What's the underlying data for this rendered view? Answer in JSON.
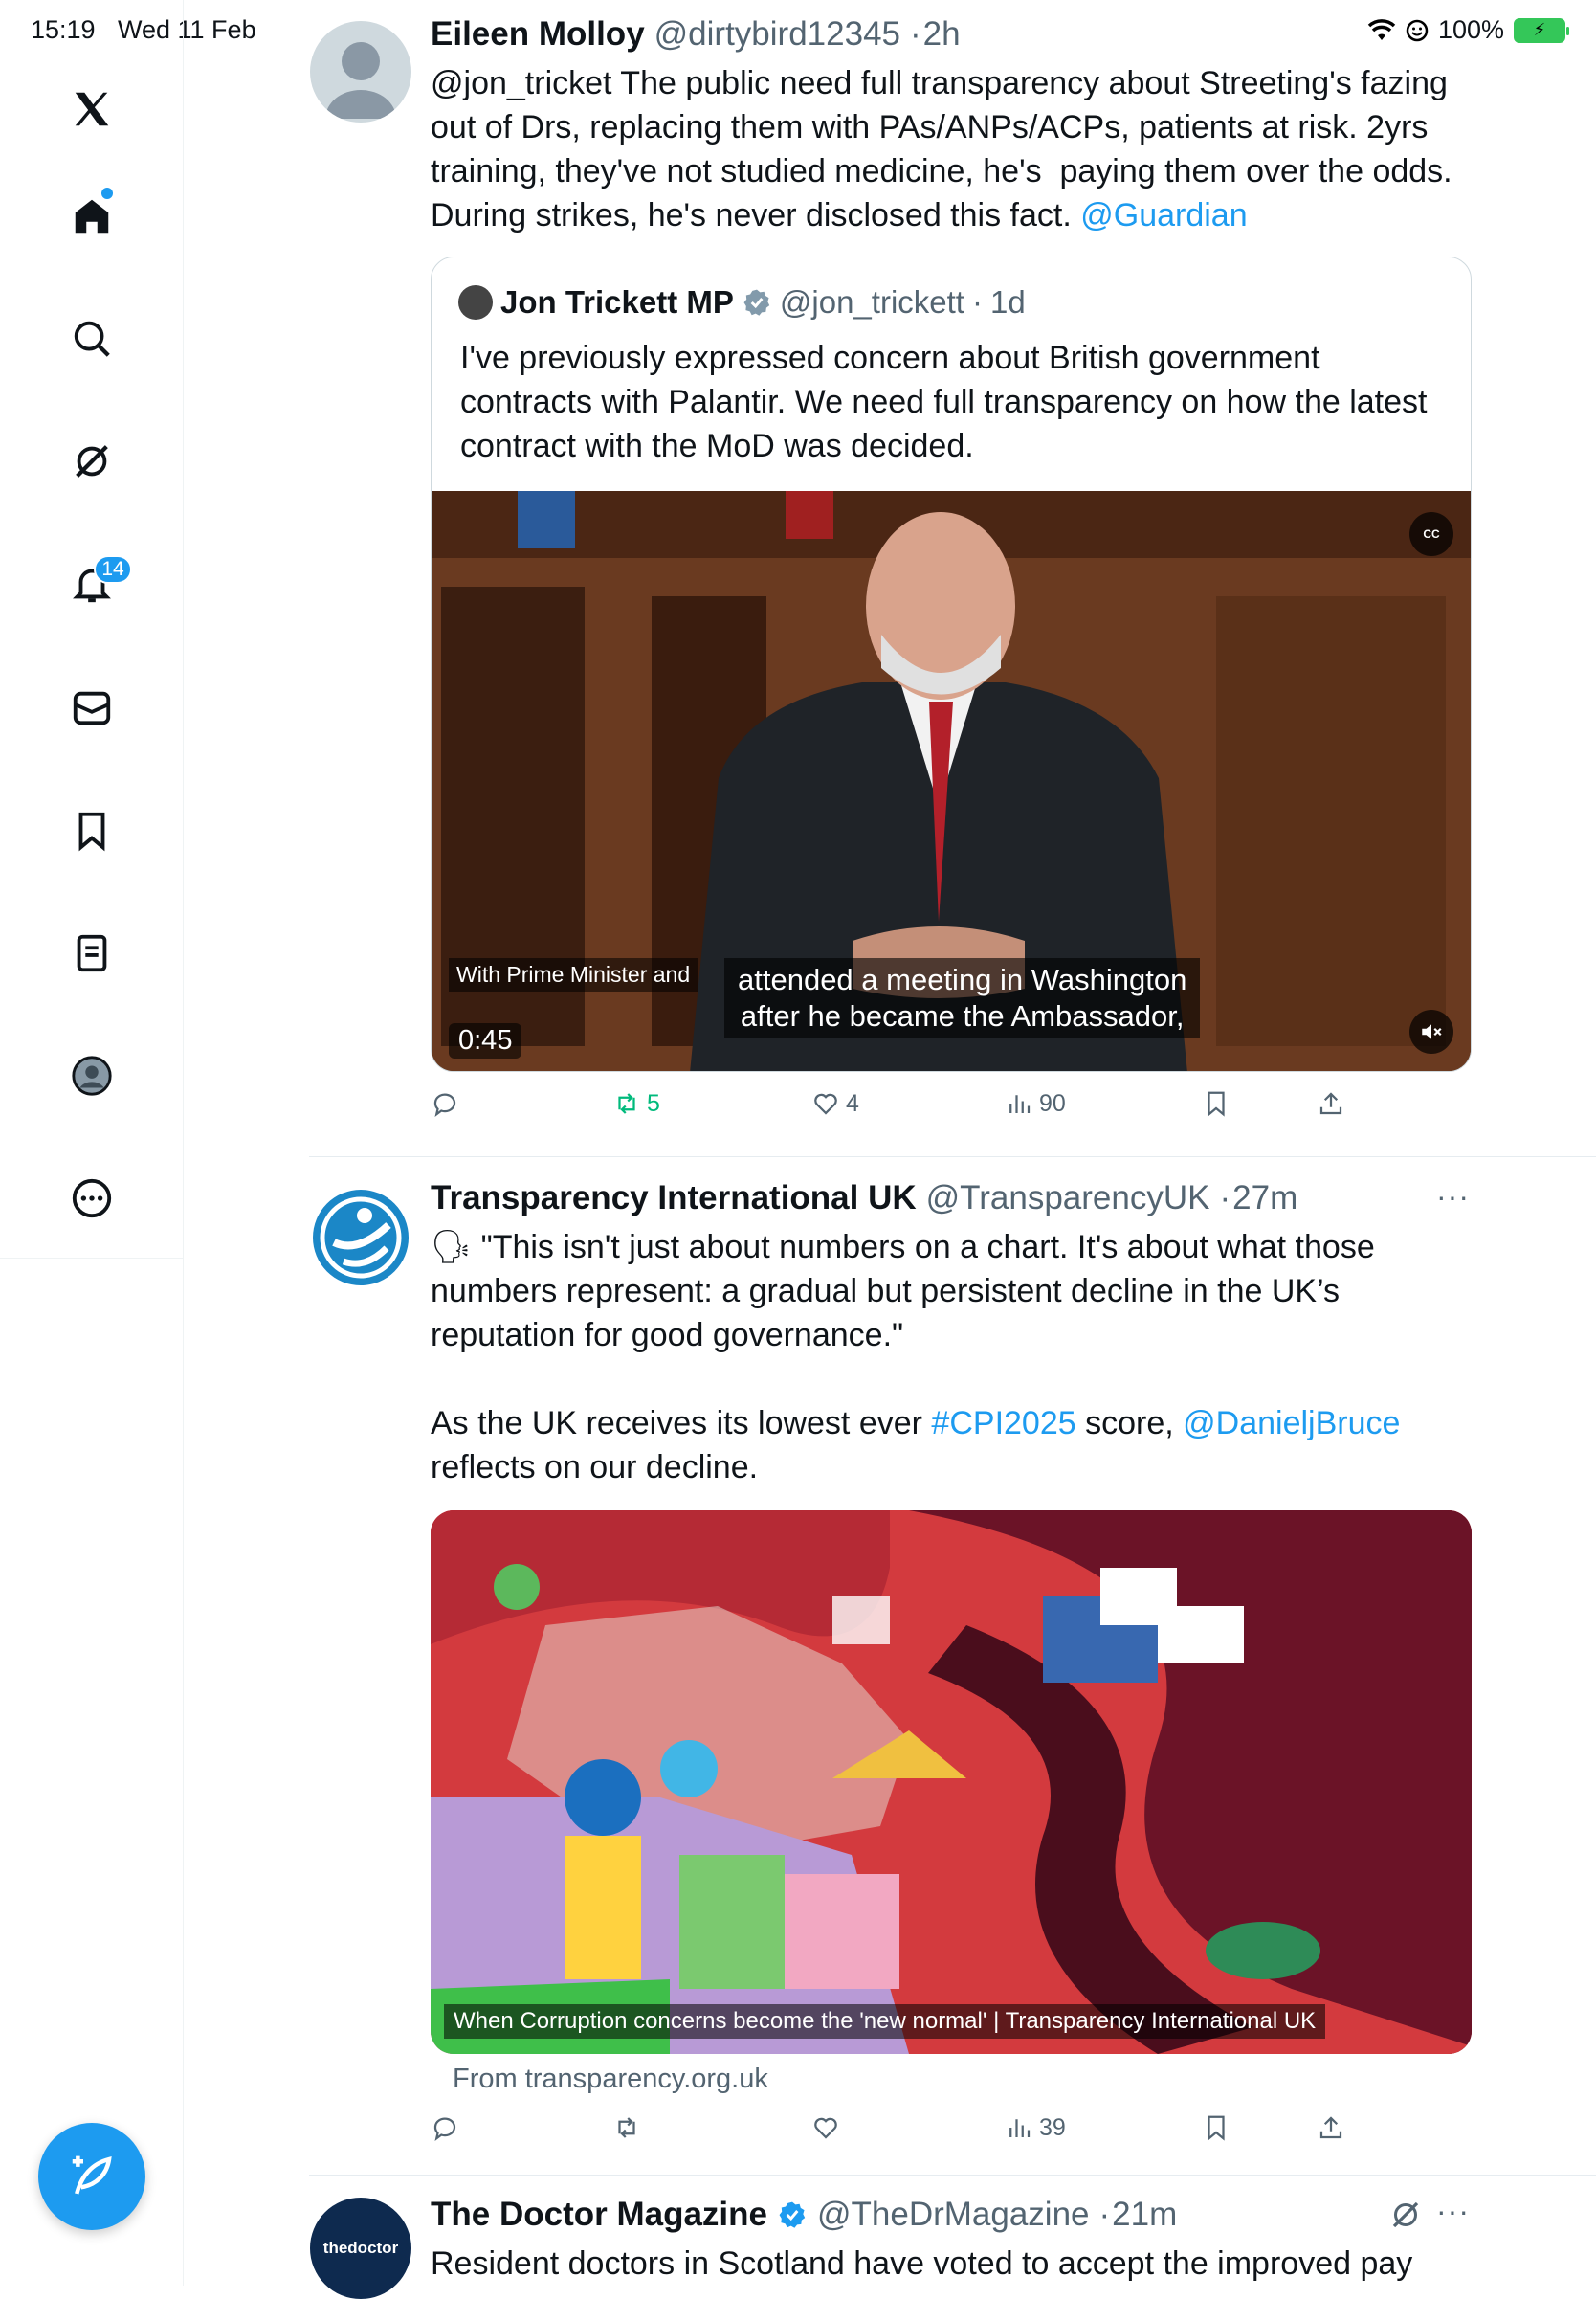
{
  "status_bar": {
    "time": "15:19",
    "date": "Wed 11 Feb",
    "battery": "100%"
  },
  "sidebar": {
    "notifications_badge": "14",
    "items": [
      "x-logo-icon",
      "home-icon",
      "search-icon",
      "grok-icon",
      "notifications-icon",
      "messages-icon",
      "bookmarks-icon",
      "lists-icon",
      "profile-icon",
      "more-icon"
    ]
  },
  "tweets": [
    {
      "name": "Eileen Molloy",
      "handle": "@dirtybird12345",
      "time": "2h",
      "text_main": "@jon_tricket The public need full transparency about Streeting's fazing out of Drs, replacing them with PAs/ANPs/ACPs, patients at risk. 2yrs training, they've not studied medicine, he's  paying them over the odds. During strikes, he's never disclosed this fact. ",
      "text_link": "@Guardian",
      "quote": {
        "name": "Jon Trickett MP",
        "handle": "@jon_trickett",
        "time": "1d",
        "text": "I've previously expressed concern about British government contracts with Palantir. We need full transparency on how the latest contract with the MoD was decided.",
        "video": {
          "subtitle_small": "With Prime Minister and",
          "subtitle_line1": "attended a meeting in Washington",
          "subtitle_line2": "after he became the Ambassador,",
          "duration": "0:45",
          "cc": "CC"
        }
      },
      "stats": {
        "reposts": "5",
        "likes": "4",
        "views": "90"
      }
    },
    {
      "name": "Transparency International UK",
      "handle": "@TransparencyUK",
      "time": "27m",
      "text_p1": "\"This isn't just about numbers on a chart. It's about what those numbers represent: a gradual but persistent decline in the UK’s reputation for good governance.\"",
      "text_p2_a": "As the UK receives its lowest ever ",
      "text_p2_tag": "#CPI2025",
      "text_p2_b": " score, ",
      "text_p2_mention": "@DanieljBruce",
      "text_p2_c": "reflects on our decline.",
      "card_caption": "When Corruption concerns become the 'new normal' | Transparency International UK",
      "card_source": "From transparency.org.uk",
      "stats": {
        "views": "39"
      }
    },
    {
      "name": "The Doctor Magazine",
      "handle": "@TheDrMagazine",
      "time": "21m",
      "avatar_text": "thedoctor",
      "text": "Resident doctors in Scotland have voted to accept the improved pay"
    }
  ],
  "separator": "·"
}
